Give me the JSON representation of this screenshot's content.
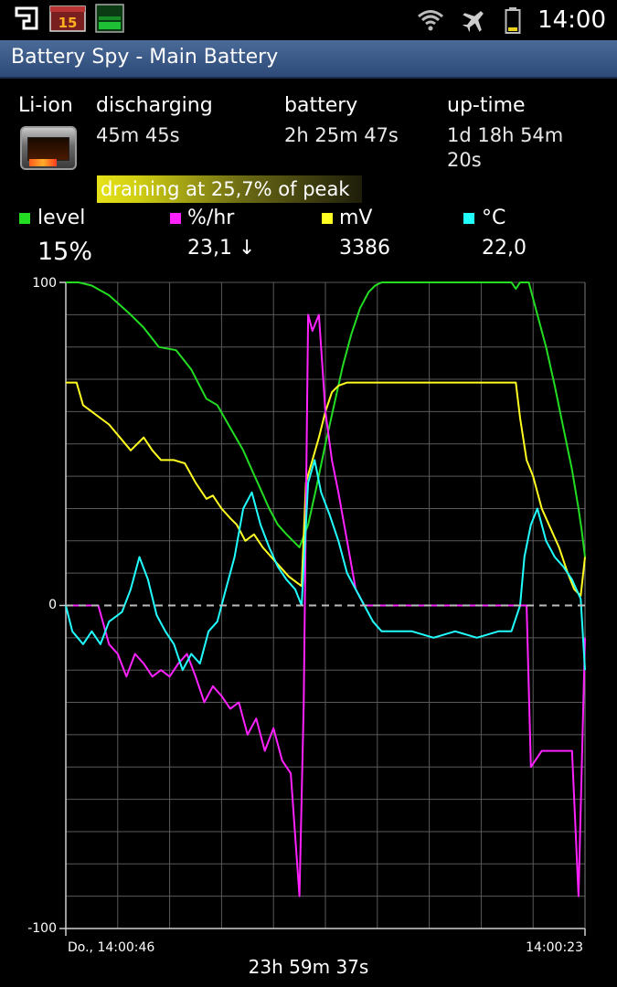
{
  "status_bar": {
    "time": "14:00",
    "notification_badge": "15",
    "icons": [
      "app-logo-icon",
      "calendar-15-icon",
      "battery-monitor-icon",
      "wifi-icon",
      "airplane-mode-icon",
      "battery-icon"
    ]
  },
  "title": "Battery Spy - Main Battery",
  "info": {
    "type_label": "Li-ion",
    "state_label": "discharging",
    "state_value": "45m 45s",
    "battery_label": "battery",
    "battery_value": "2h 25m 47s",
    "uptime_label": "up-time",
    "uptime_value_line1": "1d 18h 54m",
    "uptime_value_line2": "20s",
    "drain_text": "draining at 25,7% of peak"
  },
  "legend": [
    {
      "label": "level",
      "value": "15%",
      "color": "#22dd22"
    },
    {
      "label": "%/hr",
      "value": "23,1 ↓",
      "color": "#ff22ff"
    },
    {
      "label": "mV",
      "value": "3386",
      "color": "#ffff22"
    },
    {
      "label": "°C",
      "value": "22,0",
      "color": "#22ffff"
    }
  ],
  "chart": {
    "y_top_label": "100",
    "y_zero_label": "0",
    "y_bottom_label": "-100",
    "x_start_label": "Do., 14:00:46",
    "x_end_label": "14:00:23",
    "duration": "23h 59m 37s"
  },
  "chart_data": {
    "type": "line",
    "ylim": [
      -100,
      100
    ],
    "x_range_hours": [
      0,
      24
    ],
    "series": [
      {
        "name": "level",
        "color": "#22dd22",
        "points": [
          [
            0,
            100
          ],
          [
            0.6,
            100
          ],
          [
            1.2,
            99
          ],
          [
            2,
            96
          ],
          [
            3,
            90
          ],
          [
            3.6,
            86
          ],
          [
            4.3,
            80
          ],
          [
            5.1,
            79
          ],
          [
            5.8,
            73
          ],
          [
            6.5,
            64
          ],
          [
            7,
            62
          ],
          [
            7.6,
            55
          ],
          [
            8.2,
            48
          ],
          [
            8.6,
            42
          ],
          [
            9,
            36
          ],
          [
            9.4,
            30
          ],
          [
            9.8,
            25
          ],
          [
            10.2,
            22
          ],
          [
            10.5,
            20
          ],
          [
            10.8,
            18
          ],
          [
            11.2,
            25
          ],
          [
            11.6,
            37
          ],
          [
            12,
            50
          ],
          [
            12.4,
            62
          ],
          [
            12.8,
            74
          ],
          [
            13.2,
            84
          ],
          [
            13.6,
            92
          ],
          [
            14,
            97
          ],
          [
            14.3,
            99
          ],
          [
            14.6,
            100
          ],
          [
            20.6,
            100
          ],
          [
            20.8,
            98
          ],
          [
            21,
            100
          ],
          [
            21.4,
            100
          ],
          [
            21.8,
            90
          ],
          [
            22.2,
            80
          ],
          [
            22.6,
            68
          ],
          [
            23,
            55
          ],
          [
            23.4,
            42
          ],
          [
            23.7,
            30
          ],
          [
            23.85,
            23
          ],
          [
            24,
            15
          ]
        ]
      },
      {
        "name": "mV",
        "color": "#ffff22",
        "points": [
          [
            0,
            69
          ],
          [
            0.5,
            69
          ],
          [
            0.8,
            62
          ],
          [
            1.2,
            60
          ],
          [
            1.6,
            58
          ],
          [
            2,
            56
          ],
          [
            2.5,
            52
          ],
          [
            3,
            48
          ],
          [
            3.6,
            52
          ],
          [
            4,
            48
          ],
          [
            4.4,
            45
          ],
          [
            5,
            45
          ],
          [
            5.5,
            44
          ],
          [
            6,
            38
          ],
          [
            6.5,
            33
          ],
          [
            6.8,
            34
          ],
          [
            7.2,
            30
          ],
          [
            7.6,
            27
          ],
          [
            7.9,
            25
          ],
          [
            8.3,
            20
          ],
          [
            8.7,
            22
          ],
          [
            9.1,
            18
          ],
          [
            9.5,
            15
          ],
          [
            9.9,
            12
          ],
          [
            10.3,
            9
          ],
          [
            10.7,
            7
          ],
          [
            10.9,
            6
          ],
          [
            11.1,
            38
          ],
          [
            11.4,
            45
          ],
          [
            11.7,
            52
          ],
          [
            12,
            60
          ],
          [
            12.3,
            66
          ],
          [
            12.6,
            68
          ],
          [
            13,
            69
          ],
          [
            20.8,
            69
          ],
          [
            21,
            58
          ],
          [
            21.3,
            45
          ],
          [
            21.6,
            40
          ],
          [
            22,
            30
          ],
          [
            22.4,
            24
          ],
          [
            22.8,
            18
          ],
          [
            23.2,
            10
          ],
          [
            23.5,
            5
          ],
          [
            23.8,
            3
          ],
          [
            24,
            15
          ]
        ]
      },
      {
        "name": "%/hr",
        "color": "#ff22ff",
        "points": [
          [
            0,
            0
          ],
          [
            1.5,
            0
          ],
          [
            2,
            -12
          ],
          [
            2.4,
            -15
          ],
          [
            2.8,
            -22
          ],
          [
            3.2,
            -15
          ],
          [
            3.6,
            -18
          ],
          [
            4,
            -22
          ],
          [
            4.4,
            -20
          ],
          [
            4.8,
            -22
          ],
          [
            5.2,
            -18
          ],
          [
            5.6,
            -15
          ],
          [
            6,
            -22
          ],
          [
            6.4,
            -30
          ],
          [
            6.8,
            -25
          ],
          [
            7.2,
            -28
          ],
          [
            7.6,
            -32
          ],
          [
            8,
            -30
          ],
          [
            8.4,
            -40
          ],
          [
            8.8,
            -35
          ],
          [
            9.2,
            -45
          ],
          [
            9.6,
            -38
          ],
          [
            10,
            -48
          ],
          [
            10.4,
            -52
          ],
          [
            10.8,
            -90
          ],
          [
            11,
            -30
          ],
          [
            11.2,
            90
          ],
          [
            11.4,
            85
          ],
          [
            11.7,
            90
          ],
          [
            12,
            60
          ],
          [
            12.3,
            45
          ],
          [
            12.6,
            35
          ],
          [
            13,
            20
          ],
          [
            13.4,
            5
          ],
          [
            13.8,
            0
          ],
          [
            21.3,
            0
          ],
          [
            21.5,
            -50
          ],
          [
            22,
            -45
          ],
          [
            22.4,
            -45
          ],
          [
            23,
            -45
          ],
          [
            23.4,
            -45
          ],
          [
            23.7,
            -90
          ],
          [
            24,
            -10
          ]
        ]
      },
      {
        "name": "°C",
        "color": "#22ffff",
        "points": [
          [
            0,
            0
          ],
          [
            0.3,
            -8
          ],
          [
            0.8,
            -12
          ],
          [
            1.2,
            -8
          ],
          [
            1.6,
            -12
          ],
          [
            2,
            -5
          ],
          [
            2.6,
            -2
          ],
          [
            3,
            5
          ],
          [
            3.4,
            15
          ],
          [
            3.8,
            8
          ],
          [
            4.2,
            -3
          ],
          [
            4.6,
            -8
          ],
          [
            5,
            -12
          ],
          [
            5.4,
            -20
          ],
          [
            5.8,
            -15
          ],
          [
            6.2,
            -18
          ],
          [
            6.6,
            -8
          ],
          [
            7,
            -5
          ],
          [
            7.4,
            5
          ],
          [
            7.8,
            15
          ],
          [
            8.2,
            30
          ],
          [
            8.6,
            35
          ],
          [
            9,
            25
          ],
          [
            9.4,
            18
          ],
          [
            9.8,
            12
          ],
          [
            10.2,
            8
          ],
          [
            10.6,
            5
          ],
          [
            10.9,
            0
          ],
          [
            11.2,
            38
          ],
          [
            11.5,
            45
          ],
          [
            11.8,
            35
          ],
          [
            12.2,
            28
          ],
          [
            12.6,
            20
          ],
          [
            13,
            10
          ],
          [
            13.4,
            5
          ],
          [
            13.8,
            0
          ],
          [
            14.2,
            -5
          ],
          [
            14.6,
            -8
          ],
          [
            15,
            -8
          ],
          [
            16,
            -8
          ],
          [
            17,
            -10
          ],
          [
            18,
            -8
          ],
          [
            19,
            -10
          ],
          [
            20,
            -8
          ],
          [
            20.6,
            -8
          ],
          [
            21,
            0
          ],
          [
            21.2,
            15
          ],
          [
            21.5,
            25
          ],
          [
            21.8,
            30
          ],
          [
            22.2,
            20
          ],
          [
            22.6,
            15
          ],
          [
            23,
            12
          ],
          [
            23.4,
            8
          ],
          [
            23.8,
            2
          ],
          [
            24,
            -20
          ]
        ]
      }
    ]
  }
}
